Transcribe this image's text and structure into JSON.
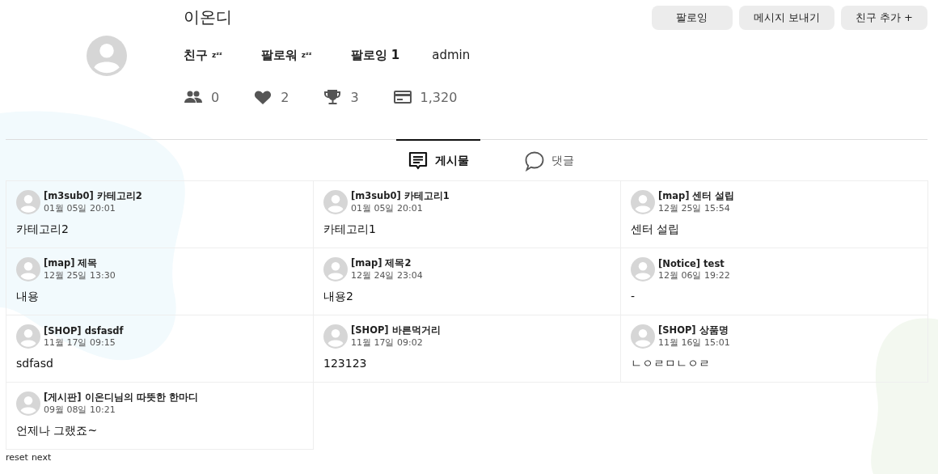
{
  "profile": {
    "name": "이온디",
    "relations": [
      {
        "label": "친구",
        "suffix": "zᶻᶻ"
      },
      {
        "label": "팔로워",
        "suffix": "zᶻᶻ"
      },
      {
        "label": "팔로잉 1"
      }
    ],
    "role": "admin",
    "stats": [
      {
        "kind": "friends",
        "value": "0"
      },
      {
        "kind": "likes",
        "value": "2"
      },
      {
        "kind": "trophies",
        "value": "3"
      },
      {
        "kind": "points",
        "value": "1,320"
      }
    ]
  },
  "actions": [
    "팔로잉",
    "메시지 보내기",
    "친구 추가 +"
  ],
  "tabs": [
    {
      "kind": "posts",
      "label": "게시물",
      "selected": true
    },
    {
      "kind": "comments",
      "label": "댓글",
      "selected": false
    }
  ],
  "posts": [
    {
      "title": "[m3sub0] 카테고리2",
      "date": "01월 05일 20:01",
      "body": "카테고리2"
    },
    {
      "title": "[m3sub0] 카테고리1",
      "date": "01월 05일 20:01",
      "body": "카테고리1"
    },
    {
      "title": "[map] 센터 설립",
      "date": "12월 25일 15:54",
      "body": "센터 설립"
    },
    {
      "title": "[map] 제목",
      "date": "12월 25일 13:30",
      "body": "내용"
    },
    {
      "title": "[map] 제목2",
      "date": "12월 24일 23:04",
      "body": "내용2"
    },
    {
      "title": "[Notice] test",
      "date": "12월 06일 19:22",
      "body": "-"
    },
    {
      "title": "[SHOP] dsfasdf",
      "date": "11월 17일 09:15",
      "body": "sdfasd"
    },
    {
      "title": "[SHOP] 바른먹거리",
      "date": "11월 17일 09:02",
      "body": "123123"
    },
    {
      "title": "[SHOP] 상품명",
      "date": "11월 16일 15:01",
      "body": "ㄴㅇㄹㅁㄴㅇㄹ"
    },
    {
      "title": "[게시판] 이온디님의 따뜻한 한마디",
      "date": "09월 08일 10:21",
      "body": "언제나 그랬죠~"
    }
  ],
  "pager": [
    "reset",
    "next"
  ]
}
